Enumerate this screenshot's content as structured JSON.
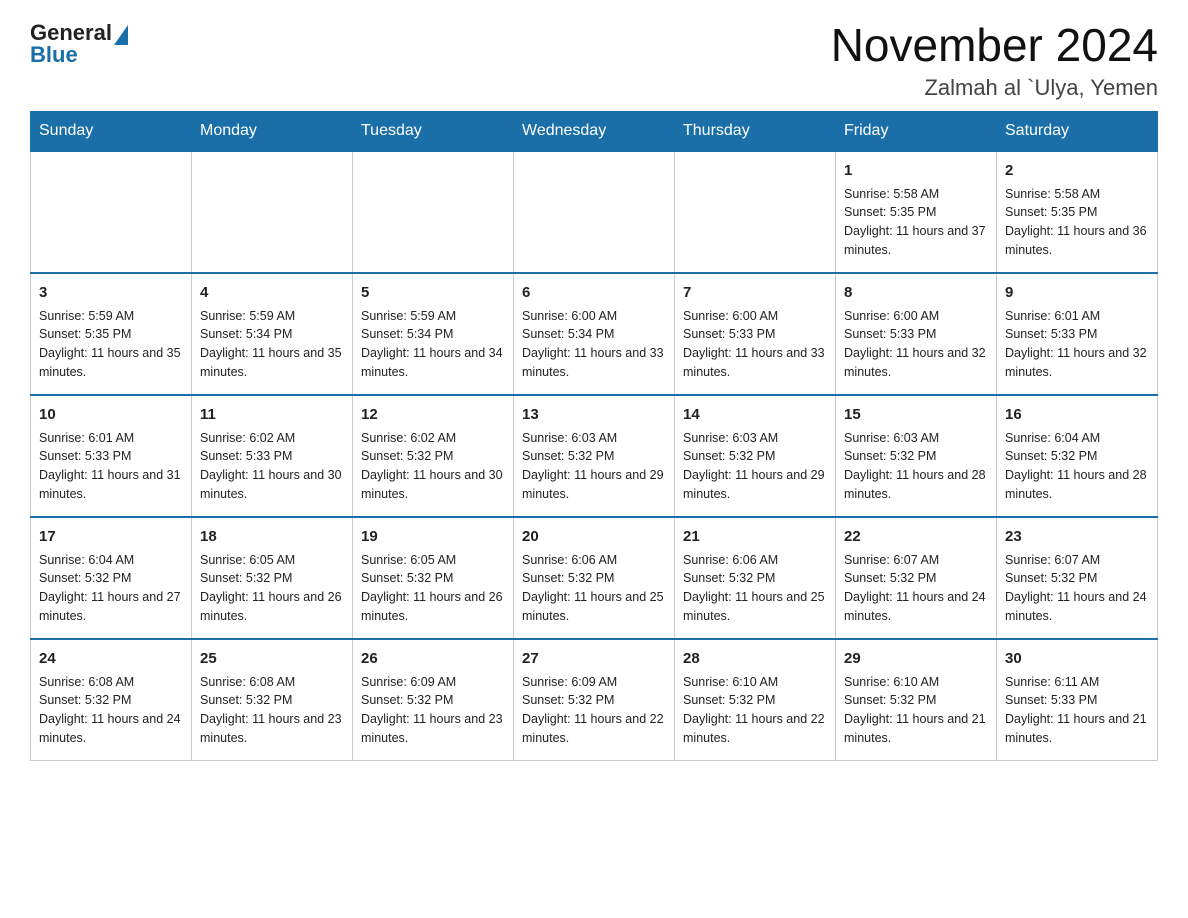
{
  "header": {
    "logo": {
      "general": "General",
      "blue": "Blue"
    },
    "title": "November 2024",
    "location": "Zalmah al `Ulya, Yemen"
  },
  "days_of_week": [
    "Sunday",
    "Monday",
    "Tuesday",
    "Wednesday",
    "Thursday",
    "Friday",
    "Saturday"
  ],
  "weeks": [
    [
      {
        "day": "",
        "info": ""
      },
      {
        "day": "",
        "info": ""
      },
      {
        "day": "",
        "info": ""
      },
      {
        "day": "",
        "info": ""
      },
      {
        "day": "",
        "info": ""
      },
      {
        "day": "1",
        "info": "Sunrise: 5:58 AM\nSunset: 5:35 PM\nDaylight: 11 hours and 37 minutes."
      },
      {
        "day": "2",
        "info": "Sunrise: 5:58 AM\nSunset: 5:35 PM\nDaylight: 11 hours and 36 minutes."
      }
    ],
    [
      {
        "day": "3",
        "info": "Sunrise: 5:59 AM\nSunset: 5:35 PM\nDaylight: 11 hours and 35 minutes."
      },
      {
        "day": "4",
        "info": "Sunrise: 5:59 AM\nSunset: 5:34 PM\nDaylight: 11 hours and 35 minutes."
      },
      {
        "day": "5",
        "info": "Sunrise: 5:59 AM\nSunset: 5:34 PM\nDaylight: 11 hours and 34 minutes."
      },
      {
        "day": "6",
        "info": "Sunrise: 6:00 AM\nSunset: 5:34 PM\nDaylight: 11 hours and 33 minutes."
      },
      {
        "day": "7",
        "info": "Sunrise: 6:00 AM\nSunset: 5:33 PM\nDaylight: 11 hours and 33 minutes."
      },
      {
        "day": "8",
        "info": "Sunrise: 6:00 AM\nSunset: 5:33 PM\nDaylight: 11 hours and 32 minutes."
      },
      {
        "day": "9",
        "info": "Sunrise: 6:01 AM\nSunset: 5:33 PM\nDaylight: 11 hours and 32 minutes."
      }
    ],
    [
      {
        "day": "10",
        "info": "Sunrise: 6:01 AM\nSunset: 5:33 PM\nDaylight: 11 hours and 31 minutes."
      },
      {
        "day": "11",
        "info": "Sunrise: 6:02 AM\nSunset: 5:33 PM\nDaylight: 11 hours and 30 minutes."
      },
      {
        "day": "12",
        "info": "Sunrise: 6:02 AM\nSunset: 5:32 PM\nDaylight: 11 hours and 30 minutes."
      },
      {
        "day": "13",
        "info": "Sunrise: 6:03 AM\nSunset: 5:32 PM\nDaylight: 11 hours and 29 minutes."
      },
      {
        "day": "14",
        "info": "Sunrise: 6:03 AM\nSunset: 5:32 PM\nDaylight: 11 hours and 29 minutes."
      },
      {
        "day": "15",
        "info": "Sunrise: 6:03 AM\nSunset: 5:32 PM\nDaylight: 11 hours and 28 minutes."
      },
      {
        "day": "16",
        "info": "Sunrise: 6:04 AM\nSunset: 5:32 PM\nDaylight: 11 hours and 28 minutes."
      }
    ],
    [
      {
        "day": "17",
        "info": "Sunrise: 6:04 AM\nSunset: 5:32 PM\nDaylight: 11 hours and 27 minutes."
      },
      {
        "day": "18",
        "info": "Sunrise: 6:05 AM\nSunset: 5:32 PM\nDaylight: 11 hours and 26 minutes."
      },
      {
        "day": "19",
        "info": "Sunrise: 6:05 AM\nSunset: 5:32 PM\nDaylight: 11 hours and 26 minutes."
      },
      {
        "day": "20",
        "info": "Sunrise: 6:06 AM\nSunset: 5:32 PM\nDaylight: 11 hours and 25 minutes."
      },
      {
        "day": "21",
        "info": "Sunrise: 6:06 AM\nSunset: 5:32 PM\nDaylight: 11 hours and 25 minutes."
      },
      {
        "day": "22",
        "info": "Sunrise: 6:07 AM\nSunset: 5:32 PM\nDaylight: 11 hours and 24 minutes."
      },
      {
        "day": "23",
        "info": "Sunrise: 6:07 AM\nSunset: 5:32 PM\nDaylight: 11 hours and 24 minutes."
      }
    ],
    [
      {
        "day": "24",
        "info": "Sunrise: 6:08 AM\nSunset: 5:32 PM\nDaylight: 11 hours and 24 minutes."
      },
      {
        "day": "25",
        "info": "Sunrise: 6:08 AM\nSunset: 5:32 PM\nDaylight: 11 hours and 23 minutes."
      },
      {
        "day": "26",
        "info": "Sunrise: 6:09 AM\nSunset: 5:32 PM\nDaylight: 11 hours and 23 minutes."
      },
      {
        "day": "27",
        "info": "Sunrise: 6:09 AM\nSunset: 5:32 PM\nDaylight: 11 hours and 22 minutes."
      },
      {
        "day": "28",
        "info": "Sunrise: 6:10 AM\nSunset: 5:32 PM\nDaylight: 11 hours and 22 minutes."
      },
      {
        "day": "29",
        "info": "Sunrise: 6:10 AM\nSunset: 5:32 PM\nDaylight: 11 hours and 21 minutes."
      },
      {
        "day": "30",
        "info": "Sunrise: 6:11 AM\nSunset: 5:33 PM\nDaylight: 11 hours and 21 minutes."
      }
    ]
  ]
}
